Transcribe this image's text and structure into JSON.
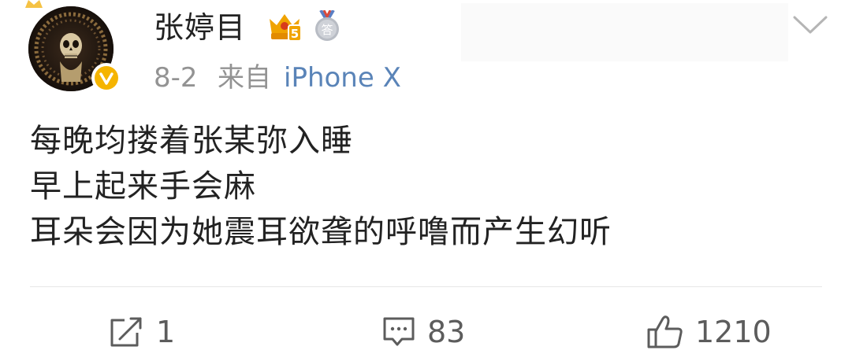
{
  "post": {
    "author": {
      "name": "张婷目",
      "avatar_icon": "skull-avatar",
      "verified_icon": "verified-v-icon",
      "vip_icon": "vip-crown-icon",
      "vip_level": "5",
      "medal_icon": "medal-icon",
      "medal_text": "答"
    },
    "time": "8-2",
    "source_prefix": "来自",
    "source": "iPhone X",
    "menu_icon": "chevron-down-icon",
    "content_lines": [
      "每晚均搂着张某弥入睡",
      "早上起来手会麻",
      "耳朵会因为她震耳欲聋的呼噜而产生幻听"
    ]
  },
  "actions": {
    "repost": {
      "icon": "repost-icon",
      "count": "1"
    },
    "comment": {
      "icon": "comment-icon",
      "count": "83"
    },
    "like": {
      "icon": "thumbs-up-icon",
      "count": "1210"
    }
  },
  "colors": {
    "text": "#222222",
    "meta": "#939393",
    "link": "#5a84b8",
    "verified": "#f5b400",
    "vip": "#f0a300",
    "action": "#5c5c5c"
  }
}
